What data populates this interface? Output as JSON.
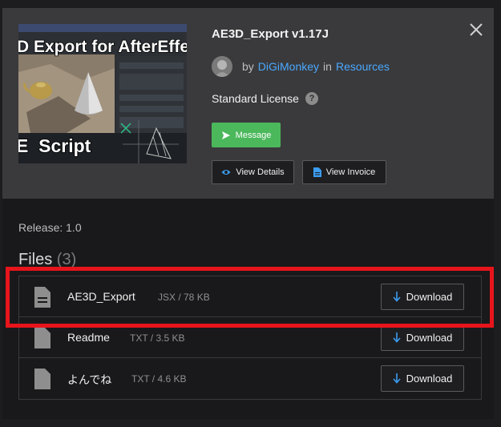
{
  "product": {
    "title": "AE3D_Export v1.17J",
    "thumbnail": {
      "heading": "D Export for AfterEffe",
      "caption": "E  Script"
    }
  },
  "author": {
    "by_label": "by",
    "name": "DiGiMonkey",
    "in_label": "in",
    "category": "Resources"
  },
  "license": {
    "label": "Standard License",
    "help_glyph": "?"
  },
  "buttons": {
    "message": "Message",
    "view_details": "View Details",
    "view_invoice": "View Invoice"
  },
  "release": {
    "label": "Release: 1.0"
  },
  "files": {
    "title": "Files",
    "count": "(3)",
    "items": [
      {
        "name": "AE3D_Export",
        "meta": "JSX / 78 KB",
        "download_label": "Download"
      },
      {
        "name": "Readme",
        "meta": "TXT / 3.5 KB",
        "download_label": "Download"
      },
      {
        "name": "よんでね",
        "meta": "TXT / 4.6 KB",
        "download_label": "Download"
      }
    ]
  },
  "colors": {
    "accent_link": "#4aa8ff",
    "message_green": "#4cb85c",
    "highlight_red": "#e8141b",
    "header_bg": "#3a3a3c"
  },
  "icons": {
    "close": "close-icon",
    "message": "send-icon",
    "details": "eye-icon",
    "invoice": "document-icon",
    "file": "file-icon",
    "download": "download-arrow-icon"
  }
}
